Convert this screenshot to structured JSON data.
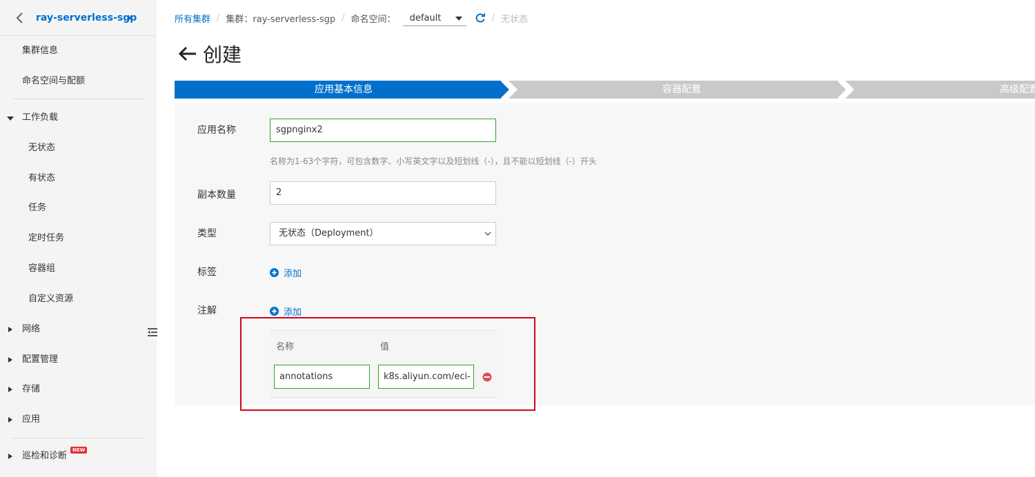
{
  "sidebar": {
    "cluster_name": "ray-serverless-sgp",
    "items": [
      {
        "label": "集群信息"
      },
      {
        "label": "命名空间与配额"
      },
      {
        "label": "工作负载"
      },
      {
        "label": "无状态"
      },
      {
        "label": "有状态"
      },
      {
        "label": "任务"
      },
      {
        "label": "定时任务"
      },
      {
        "label": "容器组"
      },
      {
        "label": "自定义资源"
      },
      {
        "label": "网络"
      },
      {
        "label": "配置管理"
      },
      {
        "label": "存储"
      },
      {
        "label": "应用"
      },
      {
        "label": "巡检和诊断"
      }
    ],
    "new_badge": "NEW"
  },
  "breadcrumb": {
    "all_clusters": "所有集群",
    "cluster": "集群：ray-serverless-sgp",
    "namespace_label": "命名空间：",
    "namespace_value": "default",
    "current": "无状态"
  },
  "page": {
    "title": "创建"
  },
  "steps": [
    {
      "label": "应用基本信息",
      "active": true
    },
    {
      "label": "容器配置",
      "active": false
    },
    {
      "label": "高级配置",
      "active": false
    }
  ],
  "form": {
    "app_name_label": "应用名称",
    "app_name_value": "sgpnginx2",
    "app_name_hint": "名称为1-63个字符，可包含数字、小写英文字以及短划线（-），且不能以短划线（-）开头",
    "replicas_label": "副本数量",
    "replicas_value": "2",
    "type_label": "类型",
    "type_value": "无状态（Deployment）",
    "labels_label": "标签",
    "annotations_label": "注解",
    "add_label": "添加",
    "annotation_table": {
      "col_name": "名称",
      "col_value": "值",
      "rows": [
        {
          "name": "annotations",
          "value": "k8s.aliyun.com/eci-"
        }
      ]
    }
  },
  "colors": {
    "accent": "#0070cc",
    "step_active": "#0070cc",
    "step_inactive": "#c9c9c9",
    "valid_border": "#2ea12e",
    "highlight": "#d0021b",
    "remove": "#d9534f"
  }
}
